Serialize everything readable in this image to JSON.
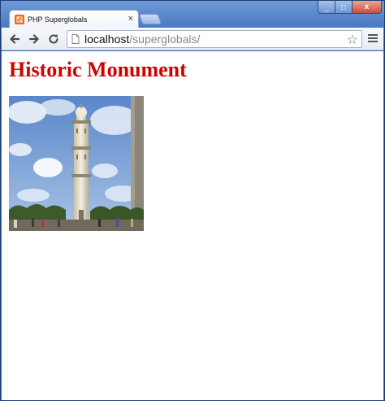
{
  "window": {
    "tab_title": "PHP Superglobals",
    "tab_close": "×",
    "controls": {
      "minimize": "_",
      "maximize": "□",
      "close": "x"
    }
  },
  "toolbar": {
    "back_icon": "back-arrow-icon",
    "forward_icon": "forward-arrow-icon",
    "reload_icon": "reload-icon",
    "url_host": "localhost",
    "url_path": "/superglobals/",
    "bookmark_icon": "star-icon",
    "menu_icon": "hamburger-menu-icon"
  },
  "page": {
    "heading": "Historic Monument",
    "image_subject": "minaret tower against blue sky"
  },
  "colors": {
    "heading": "#d40000",
    "frame": "#3f6fb5",
    "favicon": "#e96a1f"
  }
}
